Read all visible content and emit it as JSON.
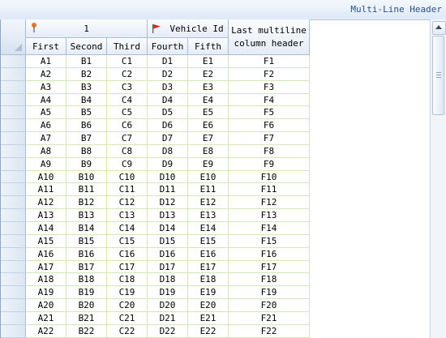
{
  "window": {
    "title": "Multi-Line Header"
  },
  "bands": {
    "band1": "1",
    "band2": "Vehicle Id",
    "last_line1": "Last multiline",
    "last_line2": "column header"
  },
  "columns": [
    "First",
    "Second",
    "Third",
    "Fourth",
    "Fifth"
  ],
  "rows": [
    [
      "A1",
      "B1",
      "C1",
      "D1",
      "E1",
      "F1"
    ],
    [
      "A2",
      "B2",
      "C2",
      "D2",
      "E2",
      "F2"
    ],
    [
      "A3",
      "B3",
      "C3",
      "D3",
      "E3",
      "F3"
    ],
    [
      "A4",
      "B4",
      "C4",
      "D4",
      "E4",
      "F4"
    ],
    [
      "A5",
      "B5",
      "C5",
      "D5",
      "E5",
      "F5"
    ],
    [
      "A6",
      "B6",
      "C6",
      "D6",
      "E6",
      "F6"
    ],
    [
      "A7",
      "B7",
      "C7",
      "D7",
      "E7",
      "F7"
    ],
    [
      "A8",
      "B8",
      "C8",
      "D8",
      "E8",
      "F8"
    ],
    [
      "A9",
      "B9",
      "C9",
      "D9",
      "E9",
      "F9"
    ],
    [
      "A10",
      "B10",
      "C10",
      "D10",
      "E10",
      "F10"
    ],
    [
      "A11",
      "B11",
      "C11",
      "D11",
      "E11",
      "F11"
    ],
    [
      "A12",
      "B12",
      "C12",
      "D12",
      "E12",
      "F12"
    ],
    [
      "A13",
      "B13",
      "C13",
      "D13",
      "E13",
      "F13"
    ],
    [
      "A14",
      "B14",
      "C14",
      "D14",
      "E14",
      "F14"
    ],
    [
      "A15",
      "B15",
      "C15",
      "D15",
      "E15",
      "F15"
    ],
    [
      "A16",
      "B16",
      "C16",
      "D16",
      "E16",
      "F16"
    ],
    [
      "A17",
      "B17",
      "C17",
      "D17",
      "E17",
      "F17"
    ],
    [
      "A18",
      "B18",
      "C18",
      "D18",
      "E18",
      "F18"
    ],
    [
      "A19",
      "B19",
      "C19",
      "D19",
      "E19",
      "F19"
    ],
    [
      "A20",
      "B20",
      "C20",
      "D20",
      "E20",
      "F20"
    ],
    [
      "A21",
      "B21",
      "C21",
      "D21",
      "E21",
      "F21"
    ],
    [
      "A22",
      "B22",
      "C22",
      "D22",
      "E22",
      "F22"
    ]
  ],
  "colors": {
    "title_text": "#2a4f86",
    "grid_line": "#d7e6b8",
    "header_border": "#a9bdd7"
  },
  "icons": {
    "band1": "pin-icon",
    "band2": "red-flag-icon"
  }
}
